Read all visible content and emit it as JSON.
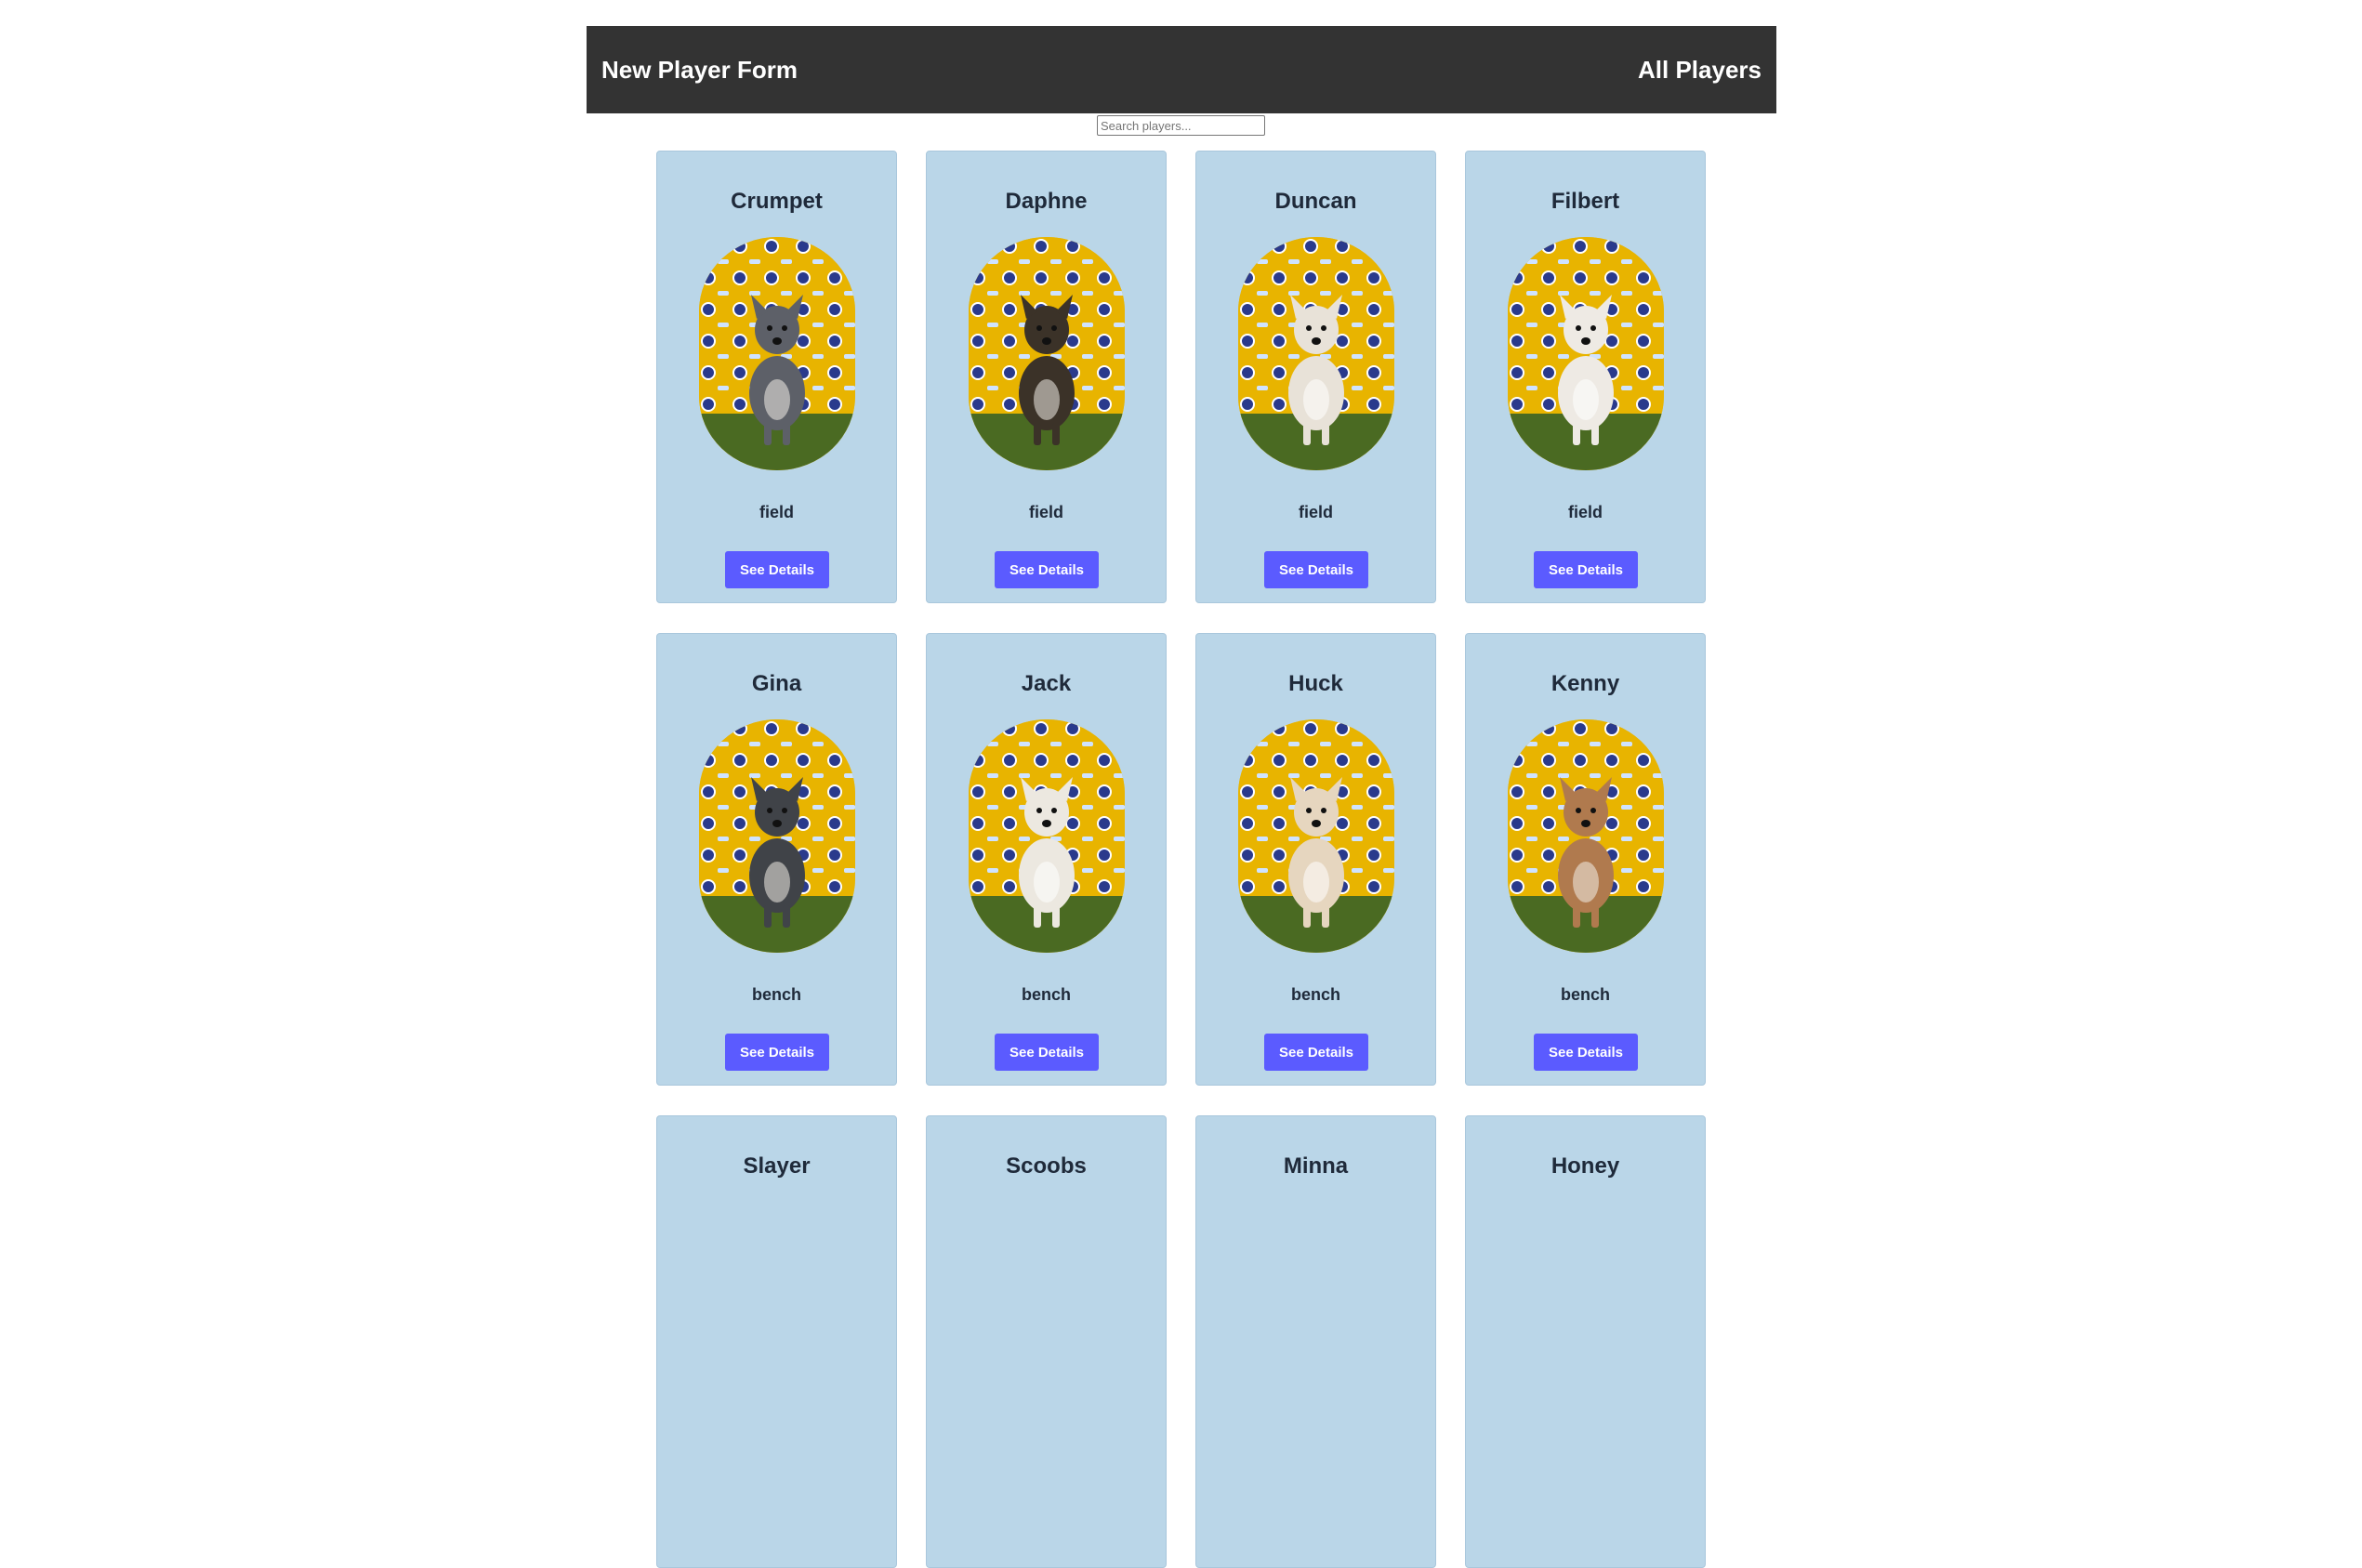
{
  "nav": {
    "form_link": "New Player Form",
    "all_link": "All Players"
  },
  "search": {
    "placeholder": "Search players...",
    "value": ""
  },
  "players": [
    {
      "name": "Crumpet",
      "status": "field",
      "button": "See Details",
      "dog_color": "#5d6068",
      "white": false
    },
    {
      "name": "Daphne",
      "status": "field",
      "button": "See Details",
      "dog_color": "#3b3228",
      "white": false
    },
    {
      "name": "Duncan",
      "status": "field",
      "button": "See Details",
      "dog_color": "#e8e2d8",
      "white": true
    },
    {
      "name": "Filbert",
      "status": "field",
      "button": "See Details",
      "dog_color": "#eeeae4",
      "white": true
    },
    {
      "name": "Gina",
      "status": "bench",
      "button": "See Details",
      "dog_color": "#404348",
      "white": false
    },
    {
      "name": "Jack",
      "status": "bench",
      "button": "See Details",
      "dog_color": "#ece8e0",
      "white": true
    },
    {
      "name": "Huck",
      "status": "bench",
      "button": "See Details",
      "dog_color": "#e6d6bf",
      "white": true
    },
    {
      "name": "Kenny",
      "status": "bench",
      "button": "See Details",
      "dog_color": "#b07a4e",
      "white": false
    },
    {
      "name": "Slayer",
      "status": "",
      "button": "",
      "dog_color": "",
      "white": false
    },
    {
      "name": "Scoobs",
      "status": "",
      "button": "",
      "dog_color": "",
      "white": false
    },
    {
      "name": "Minna",
      "status": "",
      "button": "",
      "dog_color": "",
      "white": false
    },
    {
      "name": "Honey",
      "status": "",
      "button": "",
      "dog_color": "",
      "white": false
    }
  ],
  "colors": {
    "nav_bg": "#333333",
    "card_bg": "#bad6e8",
    "button_bg": "#5b5bff",
    "backdrop_yellow": "#e8b400",
    "grass_green": "#4a6a22"
  }
}
